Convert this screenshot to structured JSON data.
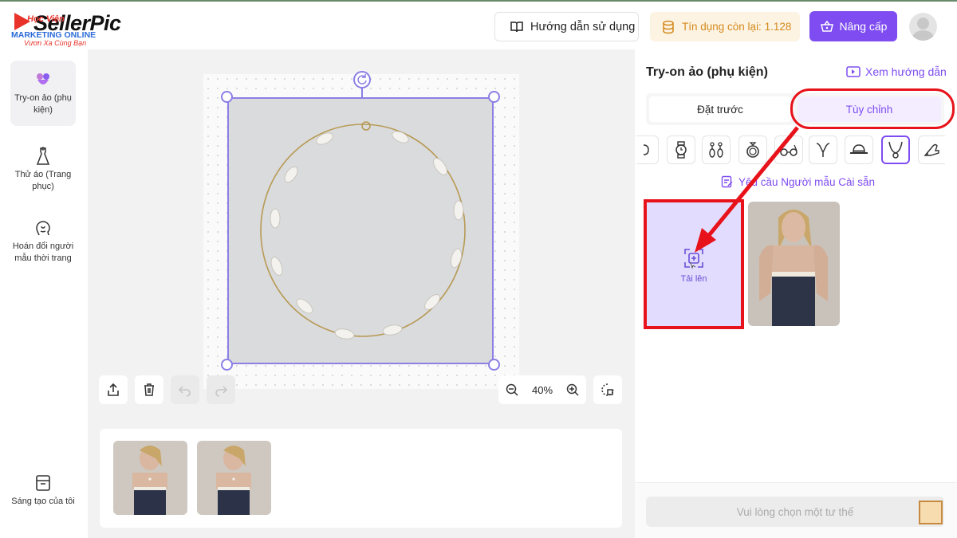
{
  "brand": {
    "name": "SellerPic",
    "overlay_top": "Học Viện",
    "overlay_line": "MARKETING ONLINE",
    "slogan": "Vươn Xa Cùng Bạn"
  },
  "header": {
    "guide_label": "Hướng dẫn sử dụng",
    "credit_label": "Tín dụng còn lại: 1.128",
    "upgrade_label": "Nâng cấp"
  },
  "sidebar": {
    "items": [
      {
        "label": "Try-on ảo (phụ kiện)",
        "icon": "accessory-icon",
        "active": true
      },
      {
        "label": "Thử áo (Trang phục)",
        "icon": "dress-icon",
        "active": false
      },
      {
        "label": "Hoán đổi người mẫu thời trang",
        "icon": "face-swap-icon",
        "active": false
      }
    ],
    "bottom_item": {
      "label": "Sáng tạo của tôi",
      "icon": "archive-icon"
    }
  },
  "canvas": {
    "zoom_label": "40%",
    "image_subject": "necklace"
  },
  "history": {
    "thumbnails": [
      "model-wearing-necklace-1",
      "model-wearing-necklace-2"
    ]
  },
  "panel": {
    "title": "Try-on ảo (phụ kiện)",
    "guide_link": "Xem hướng dẫn",
    "tabs": [
      {
        "label": "Đặt trước",
        "active": false
      },
      {
        "label": "Tùy chỉnh",
        "active": true
      }
    ],
    "categories": [
      "earring-icon",
      "watch-icon",
      "drop-earring-icon",
      "ring-icon",
      "glasses-icon",
      "collar-icon",
      "hat-icon",
      "necklace-icon",
      "heel-icon"
    ],
    "selected_category": "necklace-icon",
    "request_link": "Yêu cầu Người mẫu Cài sẵn",
    "upload_label": "Tải lên",
    "pose_placeholder": "Vui lòng chọn một tư thế"
  },
  "colors": {
    "accent": "#7e4cf0",
    "annotation": "#e8121a",
    "credit": "#d38a1d"
  }
}
